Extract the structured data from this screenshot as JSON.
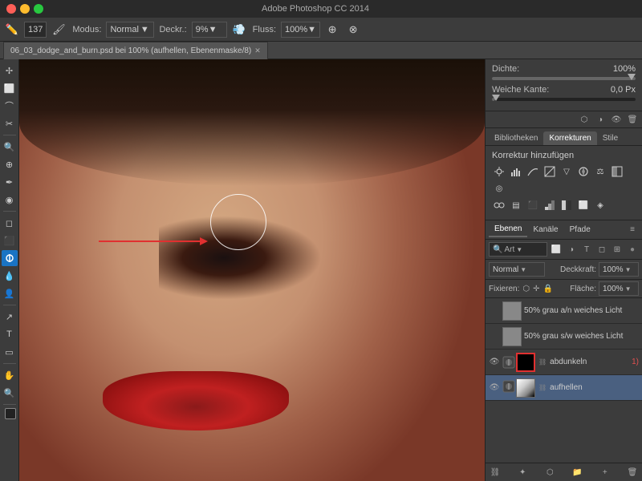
{
  "titlebar": {
    "title": "Adobe Photoshop CC 2014"
  },
  "toolbar": {
    "brush_size": "137",
    "mode_label": "Modus:",
    "mode_value": "Normal",
    "opacity_label": "Deckr.:",
    "opacity_value": "9%",
    "flow_label": "Fluss:",
    "flow_value": "100%"
  },
  "tabbar": {
    "tab_name": "06_03_dodge_and_burn.psd bei 100% (aufhellen, Ebenenmaske/8)"
  },
  "properties": {
    "density_label": "Dichte:",
    "density_value": "100%",
    "softedge_label": "Weiche Kante:",
    "softedge_value": "0,0 Px"
  },
  "panel_tabs": {
    "bibliotheken": "Bibliotheken",
    "korrekturen": "Korrekturen",
    "stile": "Stile"
  },
  "corrections": {
    "title": "Korrektur hinzufügen"
  },
  "layers_tabs": {
    "ebenen": "Ebenen",
    "kanale": "Kanäle",
    "pfade": "Pfade"
  },
  "layers_toolbar": {
    "search_placeholder": "Art",
    "search_icon": "🔍"
  },
  "layers_options": {
    "mode": "Normal",
    "opacity_label": "Deckkraft:",
    "opacity_value": "100%"
  },
  "fix_row": {
    "fixieren": "Fixieren:",
    "flache_label": "Fläche:",
    "flache_value": "100%"
  },
  "layers": [
    {
      "name": "50% grau a/n weiches Licht",
      "visible": true,
      "has_mask": false,
      "thumb_color": "#888",
      "active": false,
      "badge": ""
    },
    {
      "name": "50% grau s/w weiches Licht",
      "visible": true,
      "has_mask": false,
      "thumb_color": "#888",
      "active": false,
      "badge": ""
    },
    {
      "name": "abdunkeln",
      "visible": true,
      "has_mask": true,
      "mask_dark": true,
      "thumb_color": "#222",
      "active": false,
      "badge": "1)"
    },
    {
      "name": "aufhellen",
      "visible": true,
      "has_mask": true,
      "mask_dark": false,
      "thumb_color": "#222",
      "active": true,
      "badge": ""
    }
  ]
}
